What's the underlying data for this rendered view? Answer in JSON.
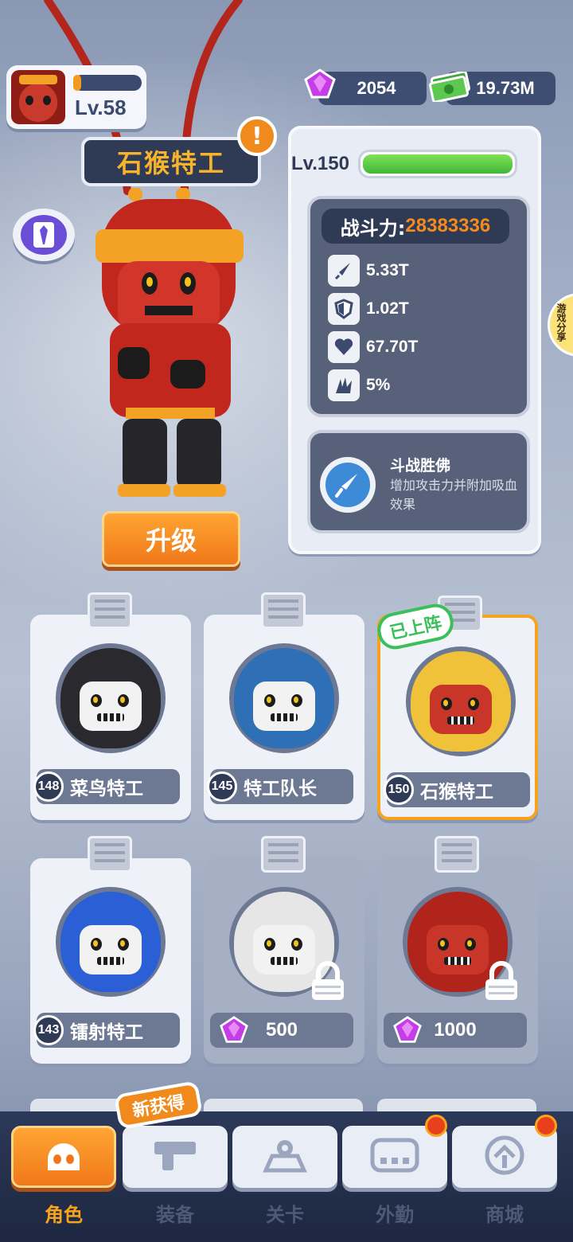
{
  "player": {
    "level": "Lv.58",
    "xp_fraction": 0.12
  },
  "currency": {
    "gems": "2054",
    "cash": "19.73M"
  },
  "hero": {
    "name": "石猴特工",
    "level": "Lv.150",
    "hp_fraction": 1.0
  },
  "stats": {
    "power_label": "战斗力:",
    "power_value": "28383336",
    "attack": "5.33T",
    "defense": "1.02T",
    "health": "67.70T",
    "crit": "5%"
  },
  "skill": {
    "name": "斗战胜佛",
    "description": "增加攻击力并附加吸血效果"
  },
  "upgrade_label": "升级",
  "side_tab_label": "游戏分享",
  "deployed_badge": "已上阵",
  "new_badge": "新获得",
  "characters": [
    {
      "level": "148",
      "name": "菜鸟特工",
      "hood": "#2a2a2e"
    },
    {
      "level": "145",
      "name": "特工队长",
      "hood": "#2f6fb6"
    },
    {
      "level": "150",
      "name": "石猴特工",
      "hood": "#f0c23a"
    },
    {
      "level": "143",
      "name": "镭射特工",
      "hood": "#2b5fd6"
    },
    {
      "price": "500",
      "hood": "#e6e6e6"
    },
    {
      "price": "1000",
      "hood": "#b0241c"
    }
  ],
  "nav": [
    {
      "label": "角色",
      "icon": "skull-icon"
    },
    {
      "label": "装备",
      "icon": "gun-icon"
    },
    {
      "label": "关卡",
      "icon": "map-icon"
    },
    {
      "label": "外勤",
      "icon": "gamepad-icon"
    },
    {
      "label": "商城",
      "icon": "shop-icon"
    }
  ],
  "colors": {
    "accent": "#f7a31e",
    "panel": "#576179",
    "power": "#f38a1e",
    "deployed": "#3bbf5b"
  }
}
